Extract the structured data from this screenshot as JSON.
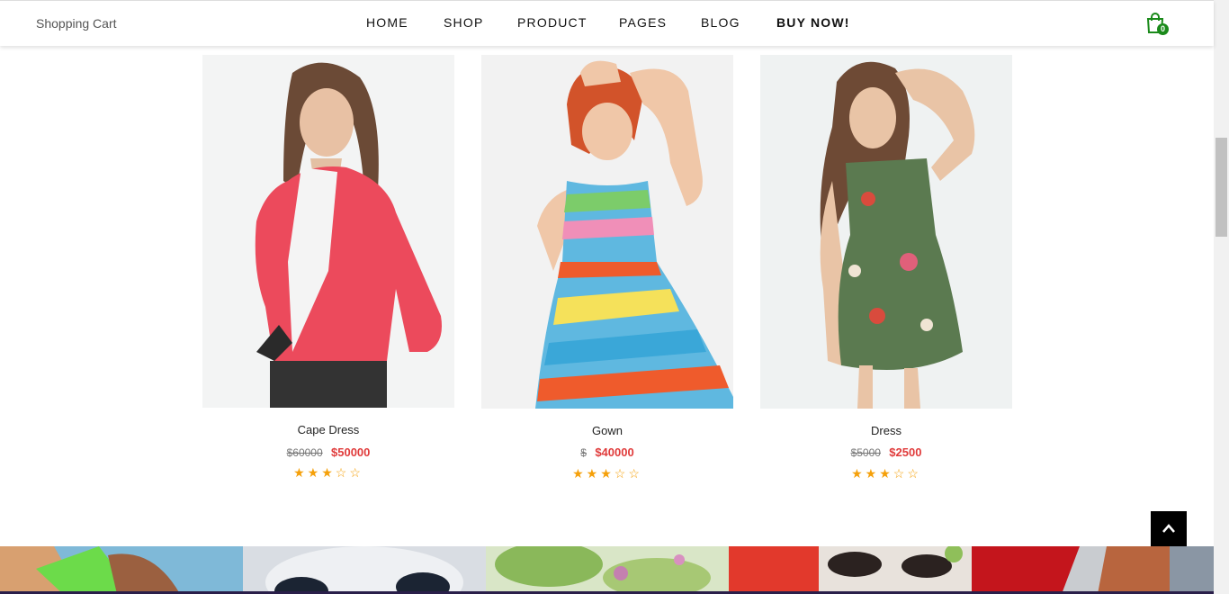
{
  "header": {
    "brand": "Shopping Cart",
    "nav": [
      "HOME",
      "SHOP",
      "PRODUCT",
      "PAGES",
      "BLOG",
      "BUY NOW!"
    ],
    "cart_count": "0"
  },
  "products": [
    {
      "name": "Cape Dress",
      "old_price": "$60000",
      "new_price": "$50000",
      "rating": 3,
      "rating_max": 5
    },
    {
      "name": "Gown",
      "old_price": "$",
      "new_price": "$40000",
      "rating": 3,
      "rating_max": 5
    },
    {
      "name": "Dress",
      "old_price": "$5000",
      "new_price": "$2500",
      "rating": 3,
      "rating_max": 5
    }
  ],
  "colors": {
    "accent_green": "#1a8a1a",
    "price_red": "#e03b3b",
    "star_orange": "#f5a00a"
  },
  "icons": {
    "cart": "shopping-bag-icon",
    "back_to_top": "chevron-up-icon",
    "star_filled": "star-filled-icon",
    "star_empty": "star-empty-icon"
  }
}
